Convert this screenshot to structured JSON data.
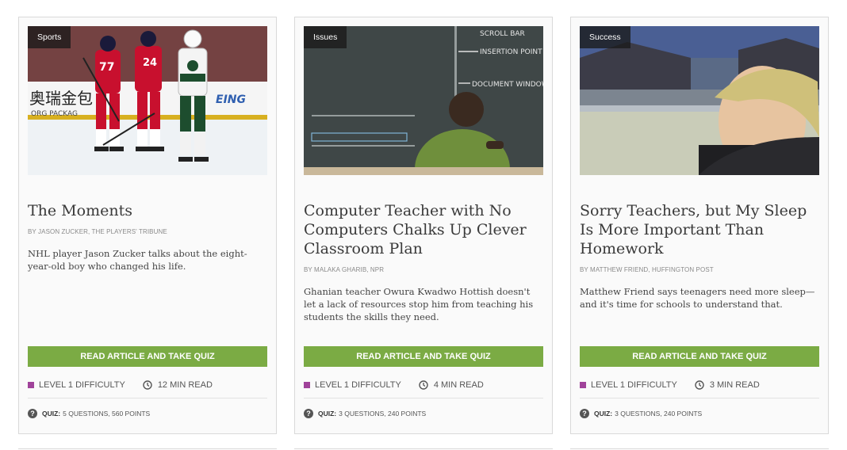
{
  "cards": [
    {
      "category": "Sports",
      "title": "The Moments",
      "byline": "BY JASON ZUCKER, THE PLAYERS' TRIBUNE",
      "description": "NHL player Jason Zucker talks about the eight-year-old boy who changed his life.",
      "button_label": "READ ARTICLE AND TAKE QUIZ",
      "difficulty": "LEVEL 1 DIFFICULTY",
      "read_time": "12 MIN READ",
      "quiz_label": "QUIZ:",
      "quiz_info": "5 QUESTIONS, 560 POINTS",
      "image_text_1": "奥瑞金包",
      "image_text_2": "ORG PACKAG",
      "image_text_3": "EING"
    },
    {
      "category": "Issues",
      "title": "Computer Teacher with No Computers Chalks Up Clever Classroom Plan",
      "byline": "BY MALAKA GHARIB, NPR",
      "description": "Ghanian teacher Owura Kwadwo Hottish doesn't let a lack of resources stop him from teaching his students the skills they need.",
      "button_label": "READ ARTICLE AND TAKE QUIZ",
      "difficulty": "LEVEL 1 DIFFICULTY",
      "read_time": "4 MIN READ",
      "quiz_label": "QUIZ:",
      "quiz_info": "3 QUESTIONS, 240 POINTS",
      "image_text_1": "SCROLL BAR",
      "image_text_2": "INSERTION POINT",
      "image_text_3": "DOCUMENT WINDOW"
    },
    {
      "category": "Success",
      "title": "Sorry Teachers, but My Sleep Is More Important Than Homework",
      "byline": "BY MATTHEW FRIEND, HUFFINGTON POST",
      "description": "Matthew Friend says teenagers need more sleep—and it's time for schools to understand that.",
      "button_label": "READ ARTICLE AND TAKE QUIZ",
      "difficulty": "LEVEL 1 DIFFICULTY",
      "read_time": "3 MIN READ",
      "quiz_label": "QUIZ:",
      "quiz_info": "3 QUESTIONS, 240 POINTS"
    }
  ],
  "colors": {
    "button": "#7bab44",
    "difficulty_marker": "#a0439a",
    "card_border": "#d9d9d9"
  },
  "icons": {
    "difficulty": "square-marker-icon",
    "read_time": "clock-icon",
    "quiz": "question-circle-icon"
  }
}
